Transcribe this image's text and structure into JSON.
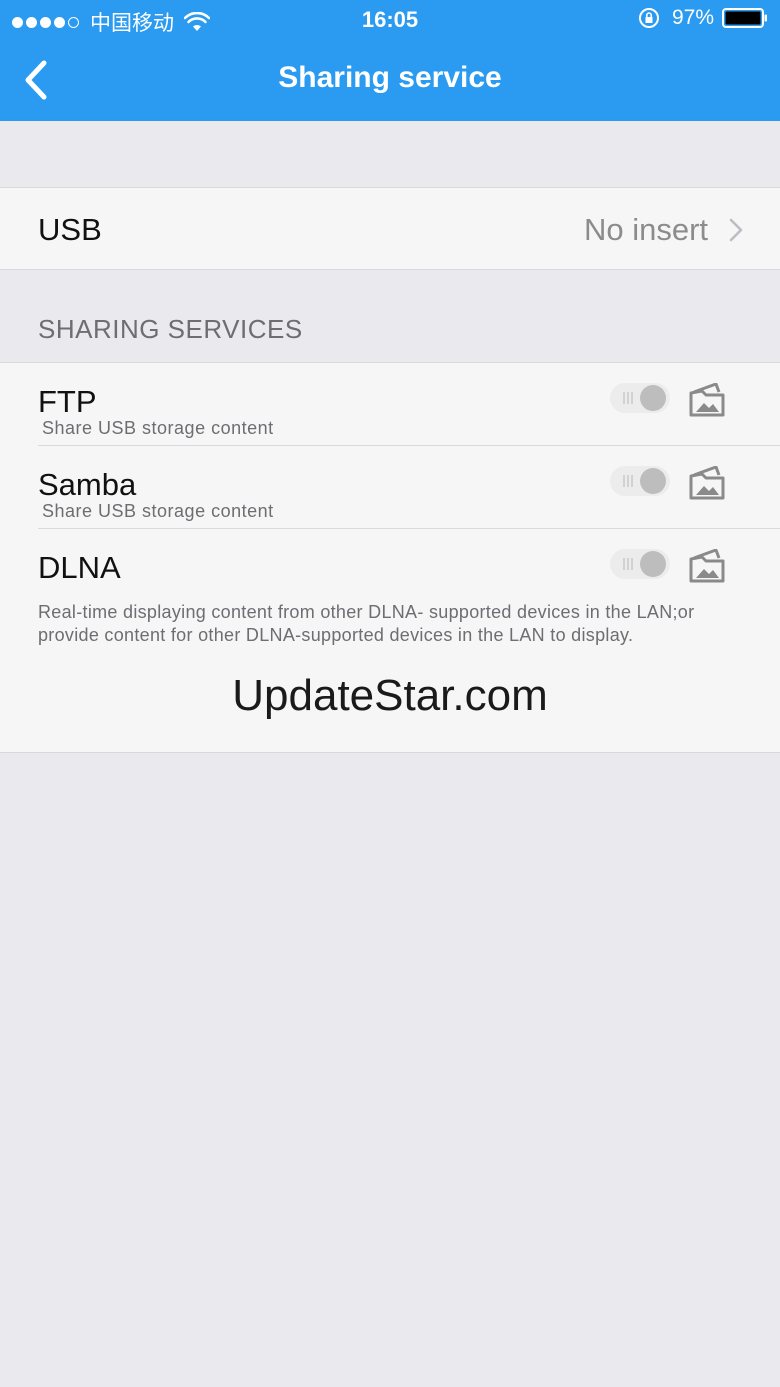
{
  "status_bar": {
    "carrier": "中国移动",
    "time": "16:05",
    "battery_percent": "97%",
    "signal_dots": 5,
    "signal_filled": 4
  },
  "nav": {
    "title": "Sharing service",
    "back_icon": "chevron-left-icon"
  },
  "usb": {
    "label": "USB",
    "value": "No insert"
  },
  "section": {
    "title": "SHARING SERVICES"
  },
  "services": [
    {
      "name": "FTP",
      "subtitle": "Share USB storage content",
      "enabled": false,
      "icon": "folder-icon"
    },
    {
      "name": "Samba",
      "subtitle": "Share USB storage content",
      "enabled": false,
      "icon": "folder-icon"
    },
    {
      "name": "DLNA",
      "subtitle": "",
      "enabled": false,
      "icon": "folder-icon"
    }
  ],
  "dlna_description": "Real-time displaying content from other DLNA- supported devices in the LAN;or provide content for other DLNA-supported devices in the LAN to display.",
  "watermark": "UpdateStar.com",
  "colors": {
    "header": "#2a9bf0",
    "background": "#e9e9ee",
    "panel": "#f6f6f6"
  }
}
